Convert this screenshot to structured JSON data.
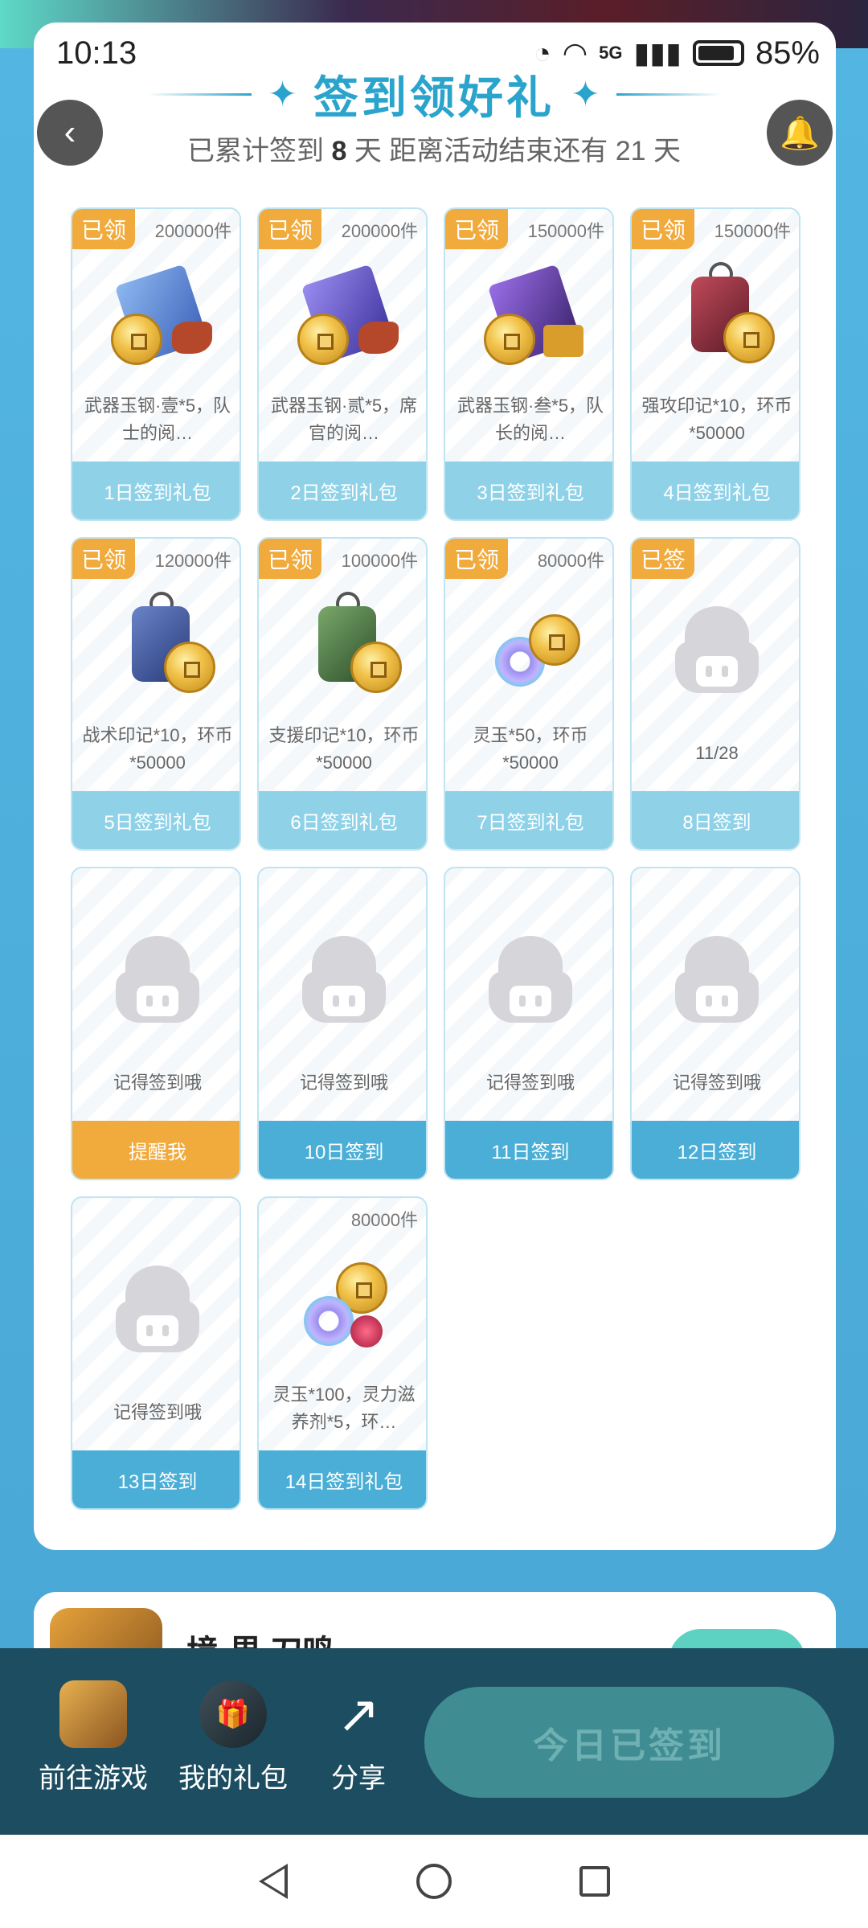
{
  "status": {
    "time": "10:13",
    "network": "5G",
    "battery": "85%"
  },
  "header": {
    "title": "签到领好礼",
    "subtitle_prefix": "已累计签到",
    "days_signed": "8",
    "subtitle_mid": "天  距离活动结束还有",
    "days_left": "21",
    "subtitle_suffix": "天"
  },
  "cells": [
    {
      "tag": "已领",
      "count": "200000件",
      "desc": "武器玉钢·壹*5，队士的阅…",
      "footer": "1日签到礼包",
      "art": "book-blue"
    },
    {
      "tag": "已领",
      "count": "200000件",
      "desc": "武器玉钢·贰*5，席官的阅…",
      "footer": "2日签到礼包",
      "art": "book-purple"
    },
    {
      "tag": "已领",
      "count": "150000件",
      "desc": "武器玉钢·叁*5，队长的阅…",
      "footer": "3日签到礼包",
      "art": "book-gold"
    },
    {
      "tag": "已领",
      "count": "150000件",
      "desc": "强攻印记*10，环币*50000",
      "footer": "4日签到礼包",
      "art": "amulet-red"
    },
    {
      "tag": "已领",
      "count": "120000件",
      "desc": "战术印记*10，环币*50000",
      "footer": "5日签到礼包",
      "art": "amulet-blue"
    },
    {
      "tag": "已领",
      "count": "100000件",
      "desc": "支援印记*10，环币*50000",
      "footer": "6日签到礼包",
      "art": "amulet-green"
    },
    {
      "tag": "已领",
      "count": "80000件",
      "desc": "灵玉*50，环币*50000",
      "footer": "7日签到礼包",
      "art": "ring-coin"
    },
    {
      "tag": "已签",
      "count": "",
      "desc": "11/28",
      "footer": "8日签到",
      "art": "placeholder"
    },
    {
      "tag": "",
      "count": "",
      "desc": "记得签到哦",
      "footer": "提醒我",
      "art": "placeholder"
    },
    {
      "tag": "",
      "count": "",
      "desc": "记得签到哦",
      "footer": "10日签到",
      "art": "placeholder"
    },
    {
      "tag": "",
      "count": "",
      "desc": "记得签到哦",
      "footer": "11日签到",
      "art": "placeholder"
    },
    {
      "tag": "",
      "count": "",
      "desc": "记得签到哦",
      "footer": "12日签到",
      "art": "placeholder"
    },
    {
      "tag": "",
      "count": "",
      "desc": "记得签到哦",
      "footer": "13日签到",
      "art": "placeholder"
    },
    {
      "tag": "",
      "count": "80000件",
      "desc": "灵玉*100，灵力滋养剂*5，环…",
      "footer": "14日签到礼包",
      "art": "ring-coin-gem"
    }
  ],
  "game": {
    "name": "境·界 刀鸣"
  },
  "actions": {
    "go_game": "前往游戏",
    "my_gifts": "我的礼包",
    "share": "分享",
    "signed_today": "今日已签到"
  },
  "colors": {
    "accent": "#2aa4cc",
    "tag_orange": "#f1aa3c",
    "footer_light": "#8fd2e8",
    "footer_blue": "#4aaed6"
  }
}
